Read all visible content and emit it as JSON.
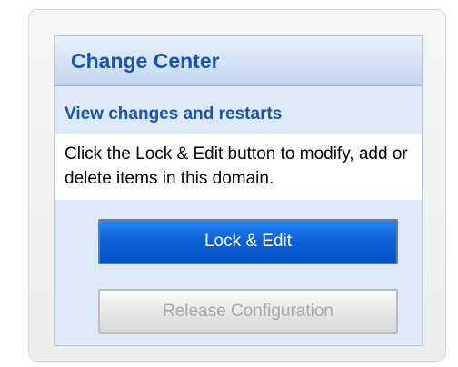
{
  "change_center": {
    "title": "Change Center",
    "view_link": "View changes and restarts",
    "instructions": "Click the Lock & Edit button to modify, add or delete items in this domain.",
    "lock_button": "Lock & Edit",
    "release_button": "Release Configuration"
  },
  "colors": {
    "title_blue": "#1a54a8",
    "lock_button_blue": "#0a5fd6",
    "panel_background": "#dde9f8",
    "disabled_text": "#a7a7a7"
  }
}
